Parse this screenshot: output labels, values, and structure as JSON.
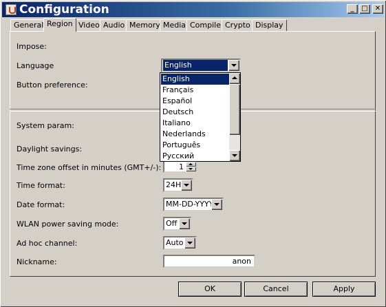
{
  "window": {
    "title": "Configuration"
  },
  "title_buttons": {
    "minimize": "_",
    "maximize": "□",
    "close": "✕"
  },
  "tabs": [
    {
      "label": "General"
    },
    {
      "label": "Region"
    },
    {
      "label": "Video"
    },
    {
      "label": "Audio"
    },
    {
      "label": "Memory"
    },
    {
      "label": "Media"
    },
    {
      "label": "Compiler"
    },
    {
      "label": "Crypto"
    },
    {
      "label": "Display"
    }
  ],
  "active_tab": "Region",
  "labels": {
    "impose": "Impose:",
    "language": "Language",
    "button_preference": "Button preference:",
    "system_param": "System param:",
    "daylight_savings": "Daylight savings:",
    "timezone": "Time zone offset in minutes (GMT+/-):",
    "time_format": "Time format:",
    "date_format": "Date format:",
    "wlan": "WLAN power saving mode:",
    "adhoc": "Ad hoc channel:",
    "nickname": "Nickname:"
  },
  "language": {
    "selected": "English",
    "options": [
      "English",
      "Français",
      "Español",
      "Deutsch",
      "Italiano",
      "Nederlands",
      "Português",
      "Русский"
    ]
  },
  "fields": {
    "timezone_value": "1",
    "time_format": "24H",
    "date_format": "MM-DD-YYYY",
    "wlan": "Off",
    "adhoc": "Auto",
    "nickname": "anon"
  },
  "buttons": {
    "ok": "OK",
    "cancel": "Cancel",
    "apply": "Apply"
  },
  "colors": {
    "face": "#d4d0c8",
    "title_start": "#0a246a",
    "title_end": "#a6caf0",
    "selection": "#0a246a"
  }
}
